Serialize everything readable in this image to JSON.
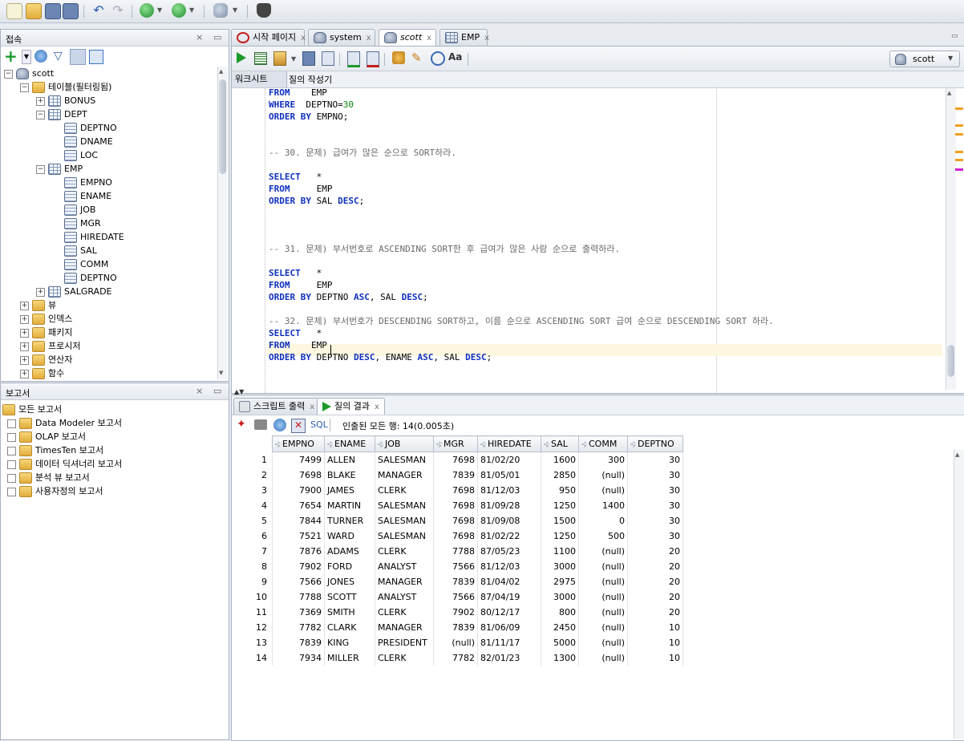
{
  "connections_panel": {
    "title": "접속",
    "close": "×",
    "min": "▭"
  },
  "reports_panel": {
    "title": "보고서",
    "close": "×",
    "min": "▭"
  },
  "tree": [
    {
      "label": "scott",
      "level": 0,
      "icon": "database-icon",
      "toggle": "−"
    },
    {
      "label": "테이블(필터링됨)",
      "level": 1,
      "icon": "folder-icon",
      "toggle": "−"
    },
    {
      "label": "BONUS",
      "level": 2,
      "icon": "table-icon",
      "toggle": "+"
    },
    {
      "label": "DEPT",
      "level": 2,
      "icon": "table-icon",
      "toggle": "−"
    },
    {
      "label": "DEPTNO",
      "level": 3,
      "icon": "column-icon",
      "toggle": ""
    },
    {
      "label": "DNAME",
      "level": 3,
      "icon": "column-icon",
      "toggle": ""
    },
    {
      "label": "LOC",
      "level": 3,
      "icon": "column-icon",
      "toggle": ""
    },
    {
      "label": "EMP",
      "level": 2,
      "icon": "table-icon",
      "toggle": "−"
    },
    {
      "label": "EMPNO",
      "level": 3,
      "icon": "column-icon",
      "toggle": ""
    },
    {
      "label": "ENAME",
      "level": 3,
      "icon": "column-icon",
      "toggle": ""
    },
    {
      "label": "JOB",
      "level": 3,
      "icon": "column-icon",
      "toggle": ""
    },
    {
      "label": "MGR",
      "level": 3,
      "icon": "column-icon",
      "toggle": ""
    },
    {
      "label": "HIREDATE",
      "level": 3,
      "icon": "column-icon",
      "toggle": ""
    },
    {
      "label": "SAL",
      "level": 3,
      "icon": "column-icon",
      "toggle": ""
    },
    {
      "label": "COMM",
      "level": 3,
      "icon": "column-icon",
      "toggle": ""
    },
    {
      "label": "DEPTNO",
      "level": 3,
      "icon": "column-icon",
      "toggle": ""
    },
    {
      "label": "SALGRADE",
      "level": 2,
      "icon": "table-icon",
      "toggle": "+"
    },
    {
      "label": "뷰",
      "level": 1,
      "icon": "folder-icon",
      "toggle": "+"
    },
    {
      "label": "인덱스",
      "level": 1,
      "icon": "folder-icon",
      "toggle": "+"
    },
    {
      "label": "패키지",
      "level": 1,
      "icon": "folder-icon",
      "toggle": "+"
    },
    {
      "label": "프로시저",
      "level": 1,
      "icon": "folder-icon",
      "toggle": "+"
    },
    {
      "label": "연산자",
      "level": 1,
      "icon": "folder-icon",
      "toggle": "+"
    },
    {
      "label": "함수",
      "level": 1,
      "icon": "folder-icon",
      "toggle": "+"
    }
  ],
  "reports": [
    {
      "label": "모든 보고서",
      "level": 0
    },
    {
      "label": "Data Modeler 보고서",
      "level": 1
    },
    {
      "label": "OLAP 보고서",
      "level": 1
    },
    {
      "label": "TimesTen 보고서",
      "level": 1
    },
    {
      "label": "데이터 딕셔너리 보고서",
      "level": 1
    },
    {
      "label": "분석 뷰 보고서",
      "level": 1
    },
    {
      "label": "사용자정의 보고서",
      "level": 1
    }
  ],
  "editor_tabs": [
    {
      "label": "시작 페이지",
      "icon": "oracle-icon",
      "active": false
    },
    {
      "label": "system",
      "icon": "sql-icon",
      "active": false
    },
    {
      "label": "scott",
      "icon": "sql-icon",
      "active": true
    },
    {
      "label": "EMP",
      "icon": "table-icon",
      "active": false
    }
  ],
  "connection_select": "scott",
  "sub_tabs": {
    "worksheet": "워크시트",
    "query_builder": "질의 작성기"
  },
  "code_lines": [
    {
      "t": "kw",
      "a": "FROM",
      "b": "    EMP"
    },
    {
      "t": "kw",
      "a": "WHERE",
      "b": "  DEPTNO=",
      "n": "30"
    },
    {
      "t": "kw",
      "a": "ORDER BY",
      "b": " EMPNO;"
    },
    {
      "t": "blank"
    },
    {
      "t": "blank"
    },
    {
      "t": "cm",
      "a": "-- 30. 문제) 급여가 많은 순으로 SORT하라."
    },
    {
      "t": "blank"
    },
    {
      "t": "kw",
      "a": "SELECT",
      "b": "   *"
    },
    {
      "t": "kw",
      "a": "FROM",
      "b": "     EMP"
    },
    {
      "t": "kw2",
      "a": "ORDER BY",
      "b": " SAL ",
      "c": "DESC",
      "d": ";"
    },
    {
      "t": "blank"
    },
    {
      "t": "blank"
    },
    {
      "t": "blank"
    },
    {
      "t": "cm",
      "a": "-- 31. 문제) 부서번호로 ASCENDING SORT한 후 급여가 많은 사람 순으로 출력하라."
    },
    {
      "t": "blank"
    },
    {
      "t": "kw",
      "a": "SELECT",
      "b": "   *"
    },
    {
      "t": "kw",
      "a": "FROM",
      "b": "     EMP"
    },
    {
      "t": "kw3",
      "a": "ORDER BY",
      "b": " DEPTNO ",
      "c": "ASC",
      "d": ", SAL ",
      "e": "DESC",
      "f": ";"
    },
    {
      "t": "blank"
    },
    {
      "t": "cm",
      "a": "-- 32. 문제) 부서번호가 DESCENDING SORT하고, 이름 순으로 ASCENDING SORT 급여 순으로 DESCENDING SORT 하라."
    },
    {
      "t": "kw",
      "a": "SELECT",
      "b": "   *"
    },
    {
      "t": "kw",
      "a": "FROM",
      "b": "    EMP"
    },
    {
      "t": "kw4",
      "a": "ORDER BY",
      "b": " DEPTNO ",
      "c": "DESC",
      "d": ", ENAME ",
      "e": "ASC",
      "f": ", SAL ",
      "g": "DESC",
      "h": ";"
    }
  ],
  "result_tabs": {
    "script_output": "스크립트 출력",
    "query_result": "질의 결과",
    "close": "x"
  },
  "result_toolbar": {
    "sql_label": "SQL",
    "status": "인출된 모든 행: 14(0.005초)"
  },
  "columns": [
    "EMPNO",
    "ENAME",
    "JOB",
    "MGR",
    "HIREDATE",
    "SAL",
    "COMM",
    "DEPTNO"
  ],
  "rows": [
    [
      "1",
      "7499",
      "ALLEN",
      "SALESMAN",
      "7698",
      "81/02/20",
      "1600",
      "300",
      "30"
    ],
    [
      "2",
      "7698",
      "BLAKE",
      "MANAGER",
      "7839",
      "81/05/01",
      "2850",
      "(null)",
      "30"
    ],
    [
      "3",
      "7900",
      "JAMES",
      "CLERK",
      "7698",
      "81/12/03",
      "950",
      "(null)",
      "30"
    ],
    [
      "4",
      "7654",
      "MARTIN",
      "SALESMAN",
      "7698",
      "81/09/28",
      "1250",
      "1400",
      "30"
    ],
    [
      "5",
      "7844",
      "TURNER",
      "SALESMAN",
      "7698",
      "81/09/08",
      "1500",
      "0",
      "30"
    ],
    [
      "6",
      "7521",
      "WARD",
      "SALESMAN",
      "7698",
      "81/02/22",
      "1250",
      "500",
      "30"
    ],
    [
      "7",
      "7876",
      "ADAMS",
      "CLERK",
      "7788",
      "87/05/23",
      "1100",
      "(null)",
      "20"
    ],
    [
      "8",
      "7902",
      "FORD",
      "ANALYST",
      "7566",
      "81/12/03",
      "3000",
      "(null)",
      "20"
    ],
    [
      "9",
      "7566",
      "JONES",
      "MANAGER",
      "7839",
      "81/04/02",
      "2975",
      "(null)",
      "20"
    ],
    [
      "10",
      "7788",
      "SCOTT",
      "ANALYST",
      "7566",
      "87/04/19",
      "3000",
      "(null)",
      "20"
    ],
    [
      "11",
      "7369",
      "SMITH",
      "CLERK",
      "7902",
      "80/12/17",
      "800",
      "(null)",
      "20"
    ],
    [
      "12",
      "7782",
      "CLARK",
      "MANAGER",
      "7839",
      "81/06/09",
      "2450",
      "(null)",
      "10"
    ],
    [
      "13",
      "7839",
      "KING",
      "PRESIDENT",
      "(null)",
      "81/11/17",
      "5000",
      "(null)",
      "10"
    ],
    [
      "14",
      "7934",
      "MILLER",
      "CLERK",
      "7782",
      "82/01/23",
      "1300",
      "(null)",
      "10"
    ]
  ]
}
